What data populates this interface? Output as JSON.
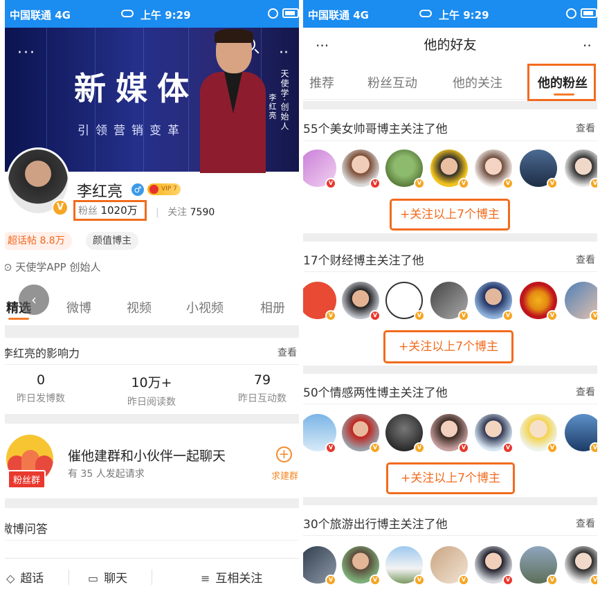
{
  "status_bar": {
    "carrier": "中国联通  4G",
    "time": "上午 9:29"
  },
  "left": {
    "banner": {
      "title": "新媒体",
      "subtitle": "引领营销变革",
      "vertical_name": "李红亮",
      "vertical_role": "天使学·创始人",
      "more_label": "···",
      "dots_label": "··"
    },
    "profile": {
      "name": "李红亮",
      "gender_symbol": "♂",
      "vip_label": "VIP 7",
      "fans_label": "粉丝",
      "fans_count": "1020万",
      "follow_label": "关注",
      "follow_count": "7590",
      "super_topic_tag": "超话帖 8.8万",
      "category_tag": "颜值博主",
      "bio": "天使学APP 创始人",
      "verified_mark": "V"
    },
    "tabs": [
      {
        "label": "精选"
      },
      {
        "label": "微博"
      },
      {
        "label": "视频"
      },
      {
        "label": "小视频"
      },
      {
        "label": "相册"
      }
    ],
    "influence": {
      "title": "李红亮的影响力",
      "see_label": "查看",
      "stats": [
        {
          "value": "0",
          "label": "昨日发博数"
        },
        {
          "value": "10万+",
          "label": "昨日阅读数"
        },
        {
          "value": "79",
          "label": "昨日互动数"
        }
      ]
    },
    "fan_group": {
      "badge": "粉丝群",
      "title": "催他建群和小伙伴一起聊天",
      "subtitle": "有 35 人发起请求",
      "action_label": "求建群",
      "action_icon": "+"
    },
    "qa": {
      "title": "微博问答"
    },
    "bottom_bar": {
      "super_topic": "超话",
      "chat": "聊天",
      "mutual": "互相关注"
    }
  },
  "right": {
    "nav": {
      "title": "他的好友",
      "more_label": "···"
    },
    "tabs": [
      {
        "label": "推荐"
      },
      {
        "label": "粉丝互动"
      },
      {
        "label": "他的关注"
      },
      {
        "label": "他的粉丝"
      }
    ],
    "sections": [
      {
        "title": "55个美女帅哥博主关注了他",
        "see_label": "查看",
        "button": "+关注以上7个博主"
      },
      {
        "title": "17个财经博主关注了他",
        "see_label": "查看",
        "button": "+关注以上7个博主"
      },
      {
        "title": "50个情感两性博主关注了他",
        "see_label": "查看",
        "button": "+关注以上7个博主"
      },
      {
        "title": "30个旅游出行博主关注了他",
        "see_label": "查看"
      }
    ],
    "badge_text": "V",
    "colors": {
      "accent": "#f26b1d",
      "status_bar": "#1b8cf0",
      "verified_gold": "#f6a623",
      "verified_red": "#e9382e"
    }
  }
}
